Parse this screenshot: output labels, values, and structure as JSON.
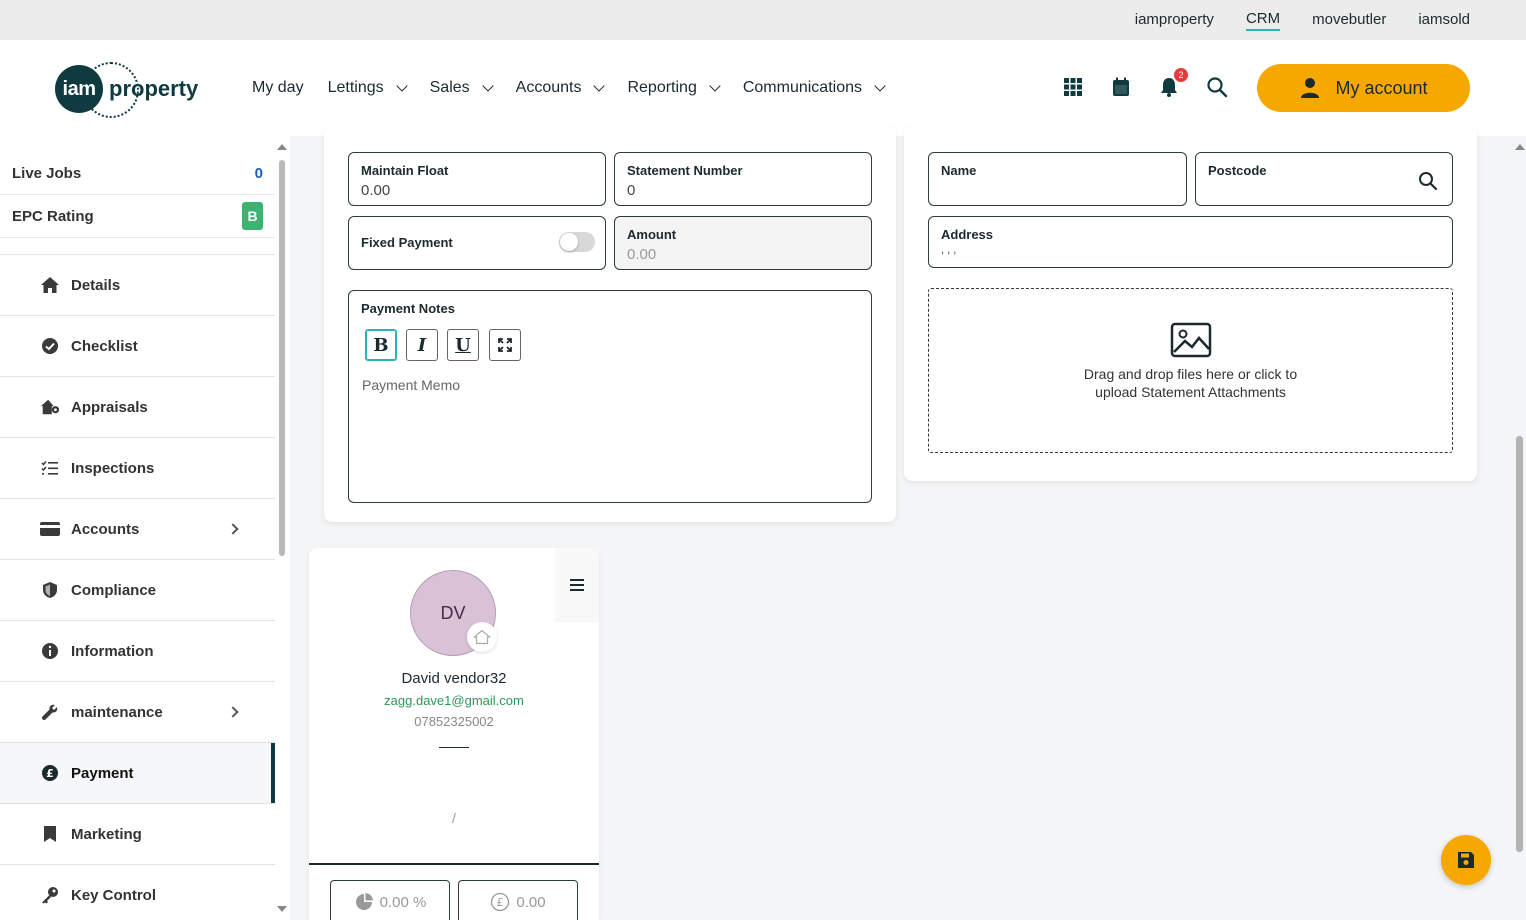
{
  "topbar": {
    "links": [
      "iamproperty",
      "CRM",
      "movebutler",
      "iamsold"
    ]
  },
  "header": {
    "logo_badge": "iam",
    "logo_word": "property",
    "nav": {
      "my_day": "My day",
      "lettings": "Lettings",
      "sales": "Sales",
      "accounts": "Accounts",
      "reporting": "Reporting",
      "communications": "Communications"
    },
    "notification_count": "2",
    "account_label": "My account"
  },
  "sidebar": {
    "live_jobs_label": "Live Jobs",
    "live_jobs_value": "0",
    "epc_label": "EPC Rating",
    "epc_value": "B",
    "menu": {
      "details": "Details",
      "checklist": "Checklist",
      "appraisals": "Appraisals",
      "inspections": "Inspections",
      "accounts": "Accounts",
      "compliance": "Compliance",
      "information": "Information",
      "maintenance": "maintenance",
      "payment": "Payment",
      "marketing": "Marketing",
      "key_control": "Key Control"
    }
  },
  "payment_form": {
    "maintain_float_label": "Maintain Float",
    "maintain_float_value": "0.00",
    "statement_number_label": "Statement Number",
    "statement_number_value": "0",
    "fixed_payment_label": "Fixed Payment",
    "amount_label": "Amount",
    "amount_value": "0.00",
    "notes_label": "Payment Notes",
    "bold": "B",
    "italic": "I",
    "underline": "U",
    "memo_placeholder": "Payment Memo"
  },
  "statement_form": {
    "name_label": "Name",
    "postcode_label": "Postcode",
    "address_label": "Address",
    "address_value": ", , ,",
    "dropzone_line1": "Drag and drop files here or click to",
    "dropzone_line2": "upload Statement Attachments"
  },
  "contact": {
    "initials": "DV",
    "name": "David vendor32",
    "email": "zagg.dave1@gmail.com",
    "phone": "07852325002",
    "slash": "/",
    "percent": "0.00 %",
    "amount": "0.00"
  },
  "colors": {
    "accent": "#f6a800",
    "brand": "#0f3b40",
    "epc": "#3cb371",
    "email": "#2a9a5a"
  }
}
